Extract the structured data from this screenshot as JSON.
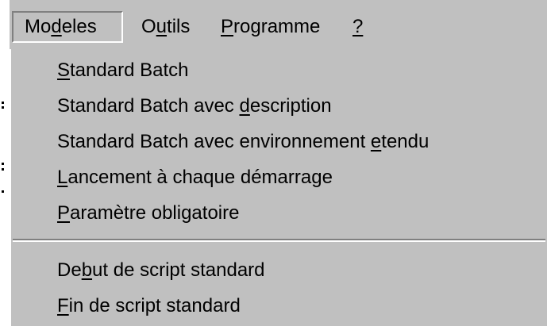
{
  "menubar": {
    "items": [
      {
        "pre": "Mo",
        "accel": "d",
        "post": "eles"
      },
      {
        "pre": "O",
        "accel": "u",
        "post": "tils"
      },
      {
        "pre": "",
        "accel": "P",
        "post": "rogramme"
      },
      {
        "pre": "",
        "accel": "?",
        "post": ""
      }
    ]
  },
  "dropdown": {
    "items": [
      {
        "pre": "",
        "accel": "S",
        "post": "tandard Batch"
      },
      {
        "pre": "Standard Batch avec ",
        "accel": "d",
        "post": "escription"
      },
      {
        "pre": "Standard Batch avec environnement ",
        "accel": "e",
        "post": "tendu"
      },
      {
        "pre": "",
        "accel": "L",
        "post": "ancement à chaque démarrage"
      },
      {
        "pre": "",
        "accel": "P",
        "post": "aramètre obligatoire"
      },
      {
        "pre": "De",
        "accel": "b",
        "post": "ut de script standard"
      },
      {
        "pre": "",
        "accel": "F",
        "post": "in de script standard"
      }
    ]
  },
  "colors": {
    "menu_bg": "#c0c0c0",
    "shadow": "#808080",
    "highlight": "#ffffff",
    "text": "#000000"
  }
}
